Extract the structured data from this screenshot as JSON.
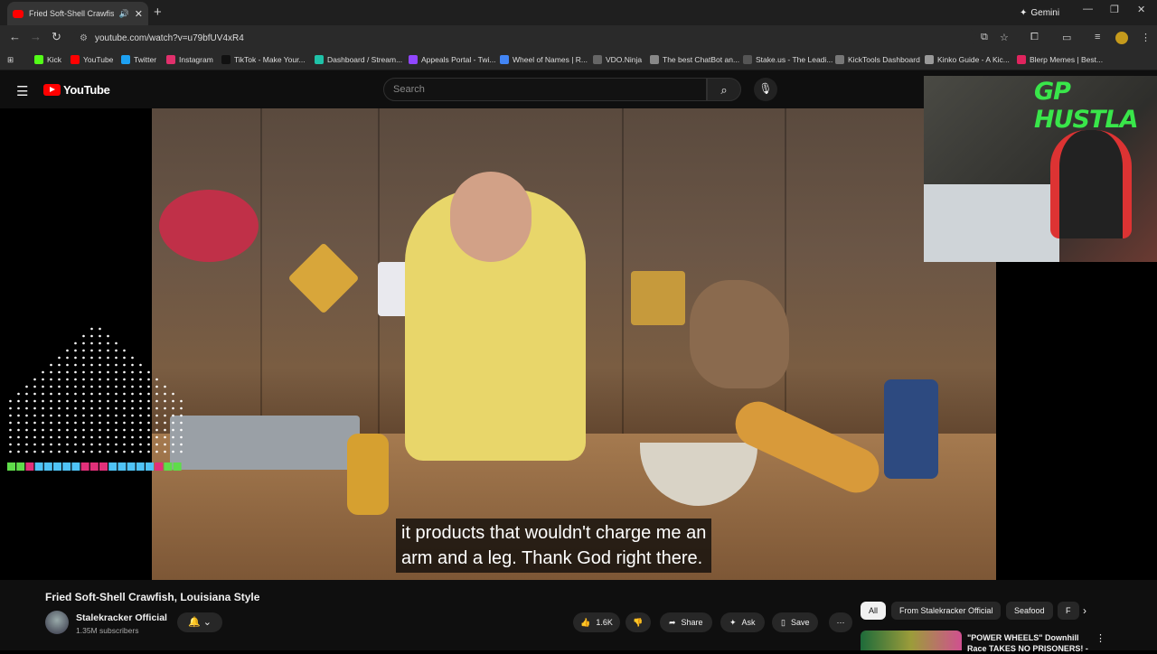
{
  "browser": {
    "tab_title": "Fried Soft-Shell Crawfish, Lo",
    "gemini_label": "Gemini",
    "url": "youtube.com/watch?v=u79bfUV4xR4"
  },
  "bookmarks": [
    {
      "label": "Kick",
      "color": "#53fc18"
    },
    {
      "label": "YouTube",
      "color": "#ff0000"
    },
    {
      "label": "Twitter",
      "color": "#1da1f2"
    },
    {
      "label": "Instagram",
      "color": "#e1306c"
    },
    {
      "label": "TikTok - Make Your...",
      "color": "#111111"
    },
    {
      "label": "Dashboard / Stream...",
      "color": "#1fc2a8"
    },
    {
      "label": "Appeals Portal - Twi...",
      "color": "#9146ff"
    },
    {
      "label": "Wheel of Names | R...",
      "color": "#4285f4"
    },
    {
      "label": "VDO.Ninja",
      "color": "#666666"
    },
    {
      "label": "The best ChatBot an...",
      "color": "#888888"
    },
    {
      "label": "Stake.us - The Leadi...",
      "color": "#555555"
    },
    {
      "label": "KickTools Dashboard",
      "color": "#777777"
    },
    {
      "label": "Kinko Guide - A Kic...",
      "color": "#999999"
    },
    {
      "label": "Blerp Memes | Best...",
      "color": "#e0245e"
    }
  ],
  "youtube": {
    "logo_text": "YouTube",
    "search_placeholder": "Search"
  },
  "video": {
    "caption_line1": "it products that wouldn't charge me an",
    "caption_line2": "arm and a leg. Thank God right there.",
    "webcam_overlay": "GP HUSTLA"
  },
  "details": {
    "title": "Fried Soft-Shell Crawfish, Louisiana Style",
    "channel": "Stalekracker Official",
    "subscribers": "1.35M subscribers",
    "likes": "1.6K",
    "share_label": "Share",
    "ask_label": "Ask",
    "save_label": "Save"
  },
  "chips": [
    "All",
    "From Stalekracker Official",
    "Seafood",
    "F"
  ],
  "recommendation": {
    "title": "\"POWER WHEELS\" Downhill Race TAKES NO PRISONERS! -"
  }
}
